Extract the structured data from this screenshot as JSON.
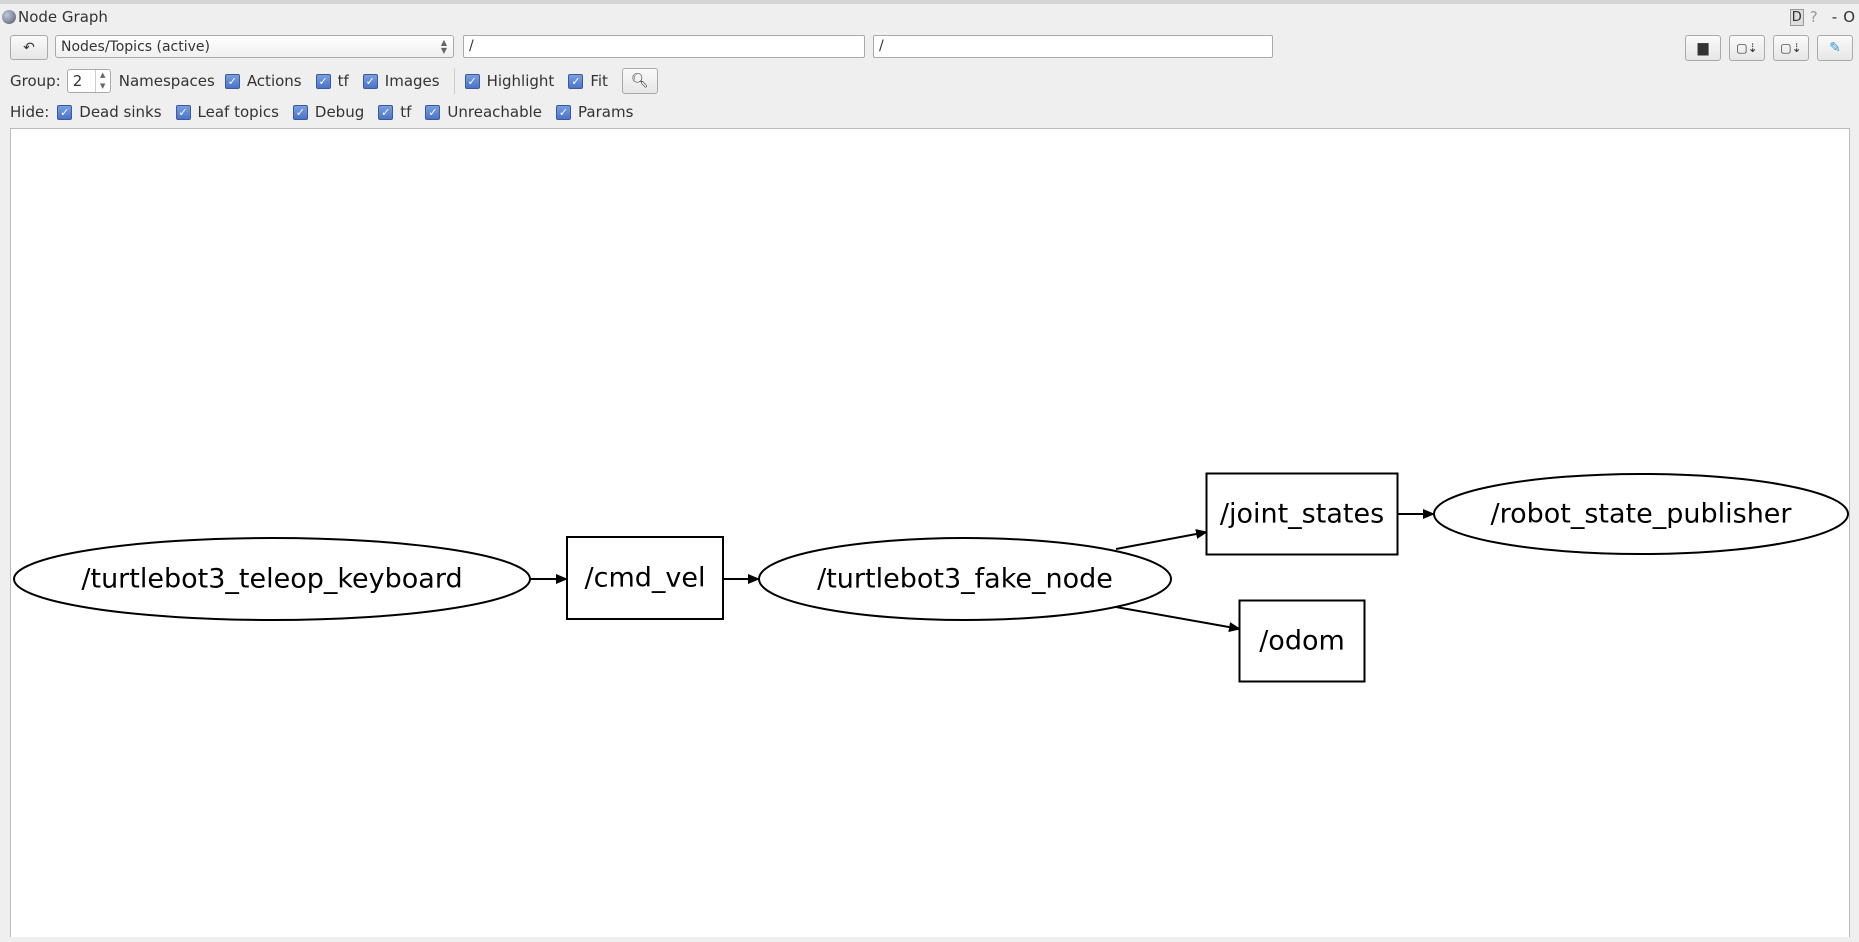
{
  "window": {
    "title": "Node Graph",
    "controls": [
      "D",
      "?",
      "-",
      "O"
    ]
  },
  "toolbar": {
    "refresh_icon": "refresh-icon",
    "graph_type": "Nodes/Topics (active)",
    "node_filter": "/",
    "topic_filter": "/",
    "right_buttons": [
      "load-dot-icon",
      "save-dot-icon",
      "save-svg-icon",
      "save-image-icon"
    ]
  },
  "options": {
    "group_label": "Group:",
    "group_value": "2",
    "namespaces_label": "Namespaces",
    "checks": [
      {
        "label": "Actions",
        "checked": true
      },
      {
        "label": "tf",
        "checked": true
      },
      {
        "label": "Images",
        "checked": true
      }
    ],
    "checks2": [
      {
        "label": "Highlight",
        "checked": true
      },
      {
        "label": "Fit",
        "checked": true
      }
    ]
  },
  "hide": {
    "label": "Hide:",
    "checks": [
      {
        "label": "Dead sinks",
        "checked": true
      },
      {
        "label": "Leaf topics",
        "checked": true
      },
      {
        "label": "Debug",
        "checked": true
      },
      {
        "label": "tf",
        "checked": true
      },
      {
        "label": "Unreachable",
        "checked": true
      },
      {
        "label": "Params",
        "checked": true
      }
    ]
  },
  "graph": {
    "nodes": [
      {
        "id": "teleop",
        "label": "/turtlebot3_teleop_keyboard",
        "shape": "ellipse"
      },
      {
        "id": "cmd_vel",
        "label": "/cmd_vel",
        "shape": "box"
      },
      {
        "id": "fake",
        "label": "/turtlebot3_fake_node",
        "shape": "ellipse"
      },
      {
        "id": "joint",
        "label": "/joint_states",
        "shape": "box"
      },
      {
        "id": "rsp",
        "label": "/robot_state_publisher",
        "shape": "ellipse"
      },
      {
        "id": "odom",
        "label": "/odom",
        "shape": "box"
      }
    ],
    "edges": [
      [
        "teleop",
        "cmd_vel"
      ],
      [
        "cmd_vel",
        "fake"
      ],
      [
        "fake",
        "joint"
      ],
      [
        "fake",
        "odom"
      ],
      [
        "joint",
        "rsp"
      ]
    ]
  }
}
